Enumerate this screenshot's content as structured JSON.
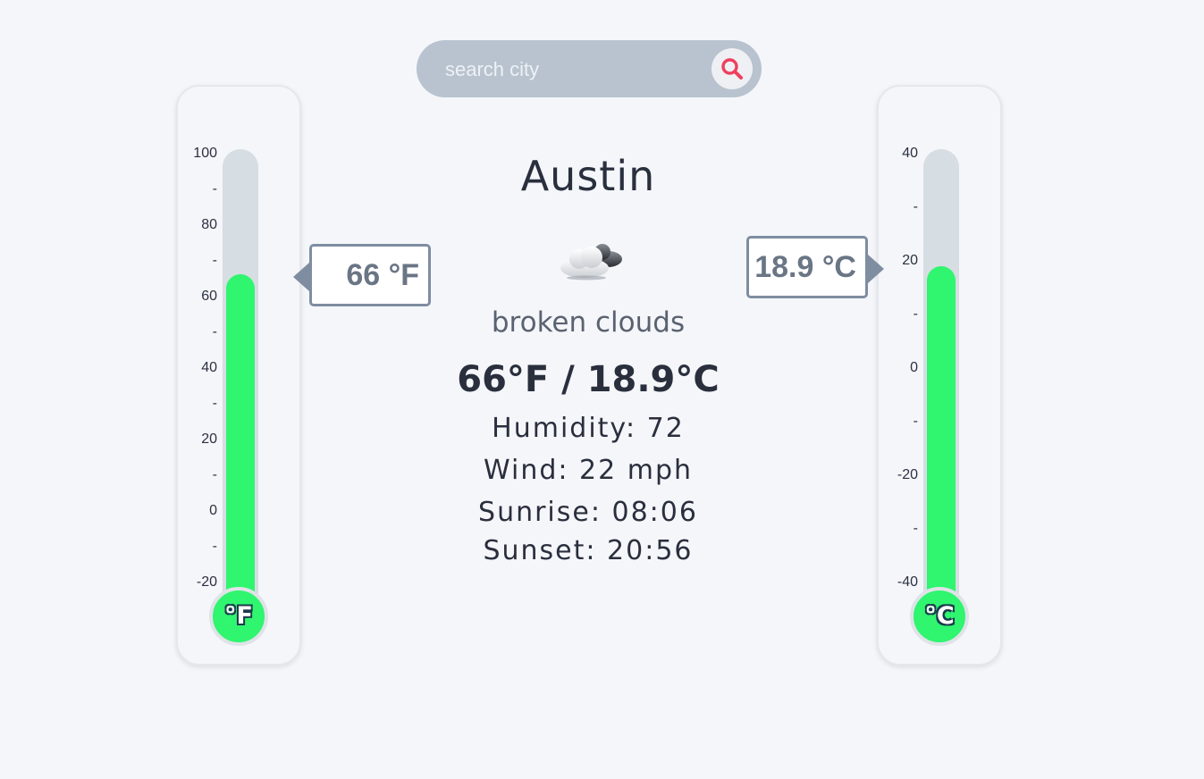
{
  "search": {
    "placeholder": "search city",
    "value": ""
  },
  "icons": {
    "search": "search-icon",
    "weather": "broken-clouds-icon"
  },
  "colors": {
    "fill": "#2ff56f",
    "tube": "#d6dde3",
    "search_bg": "#b8c3cf",
    "search_icon": "#f03e5f"
  },
  "fahrenheit": {
    "unit_label": "°F",
    "readout": "66 °F",
    "value": 66,
    "range": [
      -20,
      100
    ],
    "ticks": [
      "100",
      "-",
      "80",
      "-",
      "60",
      "-",
      "40",
      "-",
      "20",
      "-",
      "0",
      "-",
      "-20"
    ]
  },
  "celsius": {
    "unit_label": "°C",
    "readout": "18.9 °C",
    "value": 18.9,
    "range": [
      -40,
      40
    ],
    "ticks": [
      "40",
      "-",
      "20",
      "-",
      "0",
      "-",
      "-20",
      "-",
      "-40"
    ]
  },
  "weather": {
    "city": "Austin",
    "description": "broken clouds",
    "temperature": "66°F / 18.9°C",
    "humidity": "Humidity: 72",
    "wind": "Wind: 22 mph",
    "sunrise": "Sunrise: 08:06",
    "sunset": "Sunset: 20:56"
  }
}
